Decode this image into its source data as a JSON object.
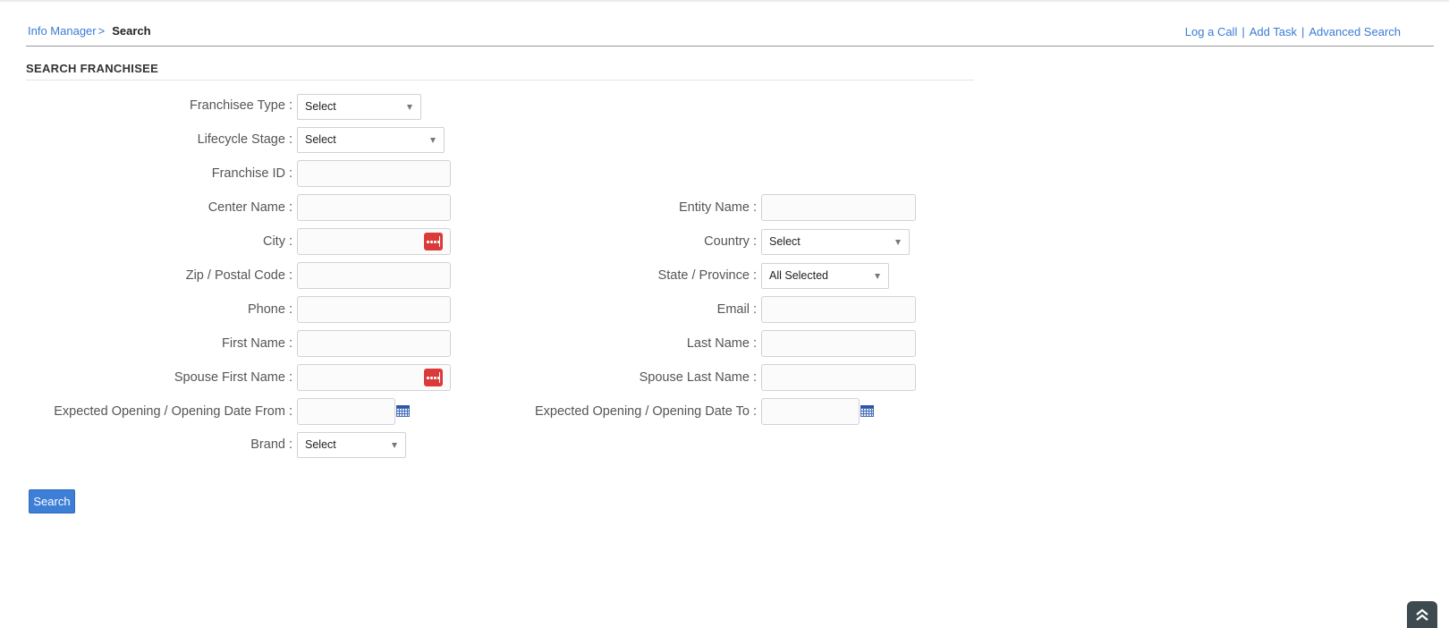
{
  "breadcrumb": {
    "root": "Info Manager",
    "separator": ">",
    "current": "Search"
  },
  "toplinks": {
    "log_call": "Log a Call",
    "add_task": "Add Task",
    "advanced_search": "Advanced Search",
    "pipe": "|"
  },
  "section": {
    "title": "SEARCH FRANCHISEE"
  },
  "form": {
    "franchisee_type": {
      "label": "Franchisee Type :",
      "value": "Select"
    },
    "lifecycle_stage": {
      "label": "Lifecycle Stage :",
      "value": "Select"
    },
    "franchise_id": {
      "label": "Franchise ID :",
      "value": ""
    },
    "center_name": {
      "label": "Center Name :",
      "value": ""
    },
    "entity_name": {
      "label": "Entity Name :",
      "value": ""
    },
    "city": {
      "label": "City :",
      "value": ""
    },
    "country": {
      "label": "Country :",
      "value": "Select"
    },
    "zip": {
      "label": "Zip / Postal Code :",
      "value": ""
    },
    "state": {
      "label": "State / Province :",
      "value": "All Selected"
    },
    "phone": {
      "label": "Phone :",
      "value": ""
    },
    "email": {
      "label": "Email :",
      "value": ""
    },
    "first_name": {
      "label": "First Name :",
      "value": ""
    },
    "last_name": {
      "label": "Last Name :",
      "value": ""
    },
    "spouse_first_name": {
      "label": "Spouse First Name :",
      "value": ""
    },
    "spouse_last_name": {
      "label": "Spouse Last Name :",
      "value": ""
    },
    "opening_from": {
      "label": "Expected Opening / Opening Date From :",
      "value": ""
    },
    "opening_to": {
      "label": "Expected Opening / Opening Date To :",
      "value": ""
    },
    "brand": {
      "label": "Brand :",
      "value": "Select"
    }
  },
  "actions": {
    "search_label": "Search"
  },
  "icons": {
    "picker": "ellipsis-icon",
    "calendar": "calendar-icon",
    "scroll_top": "double-chevron-up-icon"
  },
  "colors": {
    "link": "#3a7bd5",
    "button": "#3d7ed6",
    "picker": "#dc3a3a"
  }
}
